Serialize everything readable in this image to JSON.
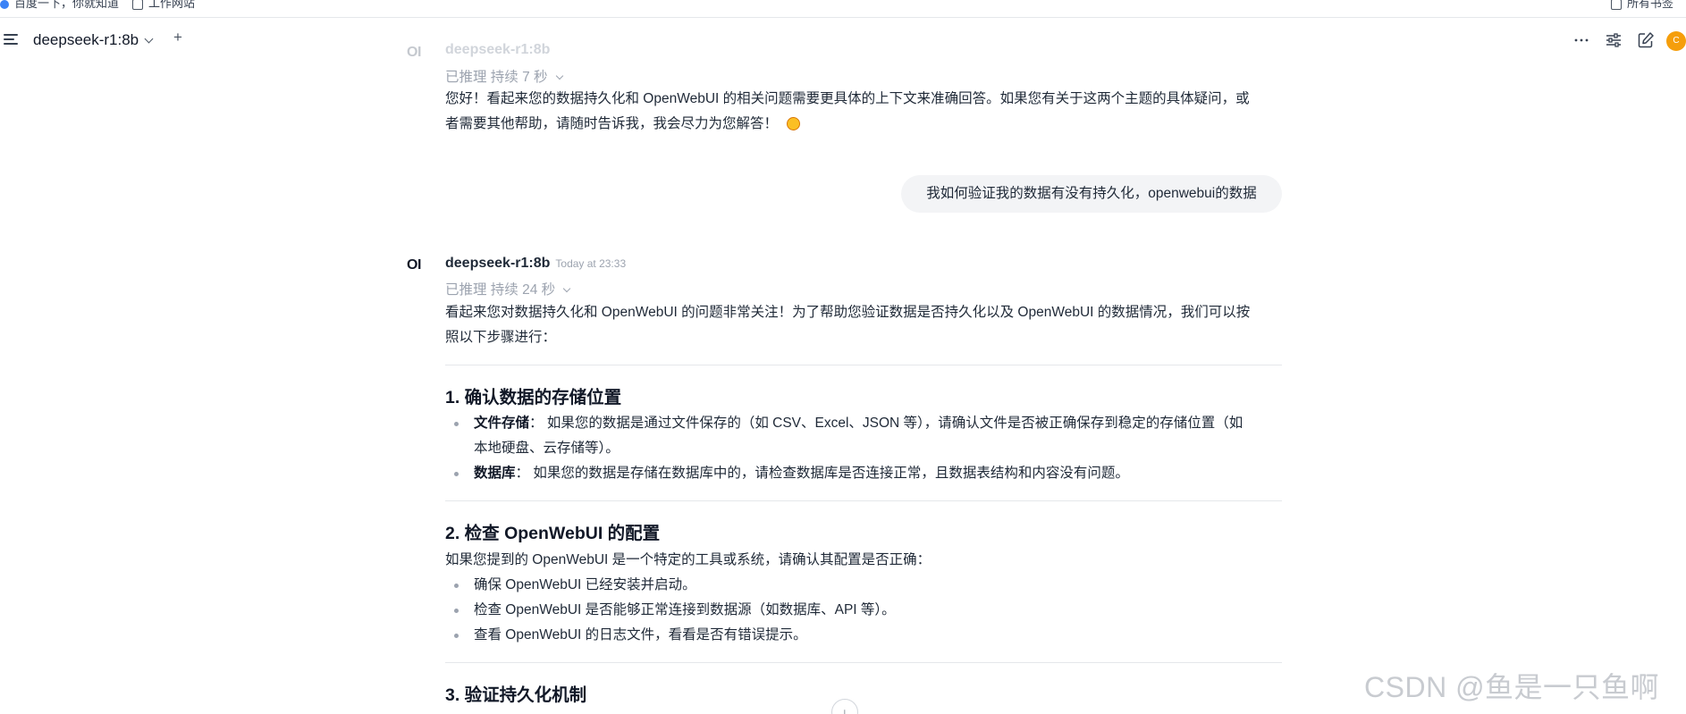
{
  "bookmarks": [
    {
      "label": "百度一下，你就知道"
    },
    {
      "label": "工作网站"
    },
    {
      "label": "所有书签"
    }
  ],
  "header": {
    "model_title": "deepseek-r1:8b",
    "new_chat": "+",
    "avatar_letter": "C",
    "accent_color": "#f59e0b"
  },
  "chat": {
    "prev_message": {
      "logo": "OI",
      "model": "deepseek-r1:8b",
      "reasoning": "已推理 持续 7 秒",
      "lines": [
        "您好！看起来您的数据持久化和 OpenWebUI 的相关问题需要更具体的上下文来准确回答。如果您有关于这两个主题的具体疑问，或",
        "者需要其他帮助，请随时告诉我，我会尽力为您解答！"
      ]
    },
    "user_message": "我如何验证我的数据有没有持久化，openwebui的数据",
    "reply": {
      "logo": "OI",
      "model": "deepseek-r1:8b",
      "timestamp": "Today at 23:33",
      "reasoning": "已推理 持续 24 秒",
      "intro_lines": [
        "看起来您对数据持久化和 OpenWebUI 的问题非常关注！为了帮助您验证数据是否持久化以及 OpenWebUI 的数据情况，我们可以按",
        "照以下步骤进行："
      ],
      "sections": [
        {
          "heading": "1. 确认数据的存储位置",
          "items": [
            {
              "bold": "文件存储",
              "text": "： 如果您的数据是通过文件保存的（如 CSV、Excel、JSON 等），请确认文件是否被正确保存到稳定的存储位置（如",
              "cont": "本地硬盘、云存储等）。"
            },
            {
              "bold": "数据库",
              "text": "： 如果您的数据是存储在数据库中的，请检查数据库是否连接正常，且数据表结构和内容没有问题。"
            }
          ]
        },
        {
          "heading": "2. 检查 OpenWebUI 的配置",
          "intro": "如果您提到的 OpenWebUI 是一个特定的工具或系统，请确认其配置是否正确：",
          "items": [
            {
              "text": "确保 OpenWebUI 已经安装并启动。"
            },
            {
              "text": "检查 OpenWebUI 是否能够正常连接到数据源（如数据库、API 等）。"
            },
            {
              "text": "查看 OpenWebUI 的日志文件，看看是否有错误提示。"
            }
          ]
        },
        {
          "heading": "3. 验证持久化机制"
        }
      ]
    }
  },
  "watermark": "CSDN @鱼是一只鱼啊"
}
